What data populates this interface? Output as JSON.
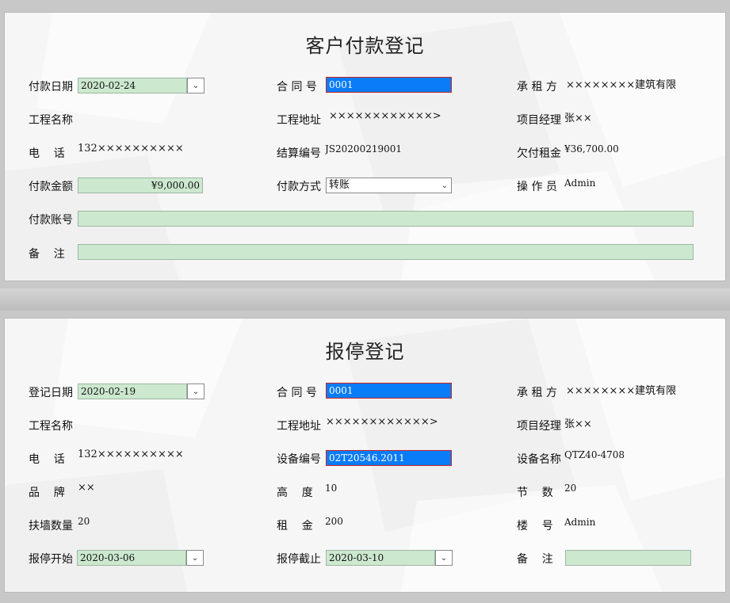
{
  "payment": {
    "title": "客户付款登记",
    "pay_date_label": "付款日期",
    "pay_date_value": "2020-02-24",
    "contract_no_label": "合 同 号",
    "contract_no_value": "0001",
    "lessee_label": "承 租 方",
    "lessee_value": "××××××××建筑有限",
    "project_name_label": "工程名称",
    "project_addr_label": "工程地址",
    "project_addr_value": "××××××××××××>",
    "manager_label": "项目经理",
    "manager_value": "张××",
    "phone_label": "电    话",
    "phone_value": "132××××××××××",
    "settle_no_label": "结算编号",
    "settle_no_value": "JS20200219001",
    "arrears_label": "欠付租金",
    "arrears_value": "¥36,700.00",
    "amount_label": "付款金额",
    "amount_value": "¥9,000.00",
    "method_label": "付款方式",
    "method_value": "转账",
    "operator_label": "操 作 员",
    "operator_value": "Admin",
    "account_label": "付款账号",
    "account_value": "",
    "remark_label": "备    注",
    "remark_value": ""
  },
  "suspend": {
    "title": "报停登记",
    "reg_date_label": "登记日期",
    "reg_date_value": "2020-02-19",
    "contract_no_label": "合 同 号",
    "contract_no_value": "0001",
    "lessee_label": "承 租 方",
    "lessee_value": "××××××××建筑有限",
    "project_name_label": "工程名称",
    "project_addr_label": "工程地址",
    "project_addr_value": "××××××××××××>",
    "manager_label": "项目经理",
    "manager_value": "张××",
    "phone_label": "电    话",
    "phone_value": "132××××××××××",
    "device_no_label": "设备编号",
    "device_no_value": "02T20546.2011",
    "device_name_label": "设备名称",
    "device_name_value": "QTZ40-4708",
    "brand_label": "品    牌",
    "brand_value": "××",
    "height_label": "高    度",
    "height_value": "10",
    "sections_label": "节    数",
    "sections_value": "20",
    "wall_label": "扶墙数量",
    "wall_value": "20",
    "rent_label": "租    金",
    "rent_value": "200",
    "floor_label": "楼    号",
    "floor_value": "Admin",
    "start_label": "报停开始",
    "start_value": "2020-03-06",
    "end_label": "报停截止",
    "end_value": "2020-03-10",
    "remark_label": "备    注",
    "remark_value": ""
  },
  "colors": {
    "field_bg": "#cce8cf",
    "selected_bg": "#0a7cf7",
    "selected_border": "#cc2222",
    "panel_bg": "#f6f6f6"
  },
  "icons": {
    "dropdown": "chevron-down-icon",
    "date_picker": "date-picker-icon"
  }
}
